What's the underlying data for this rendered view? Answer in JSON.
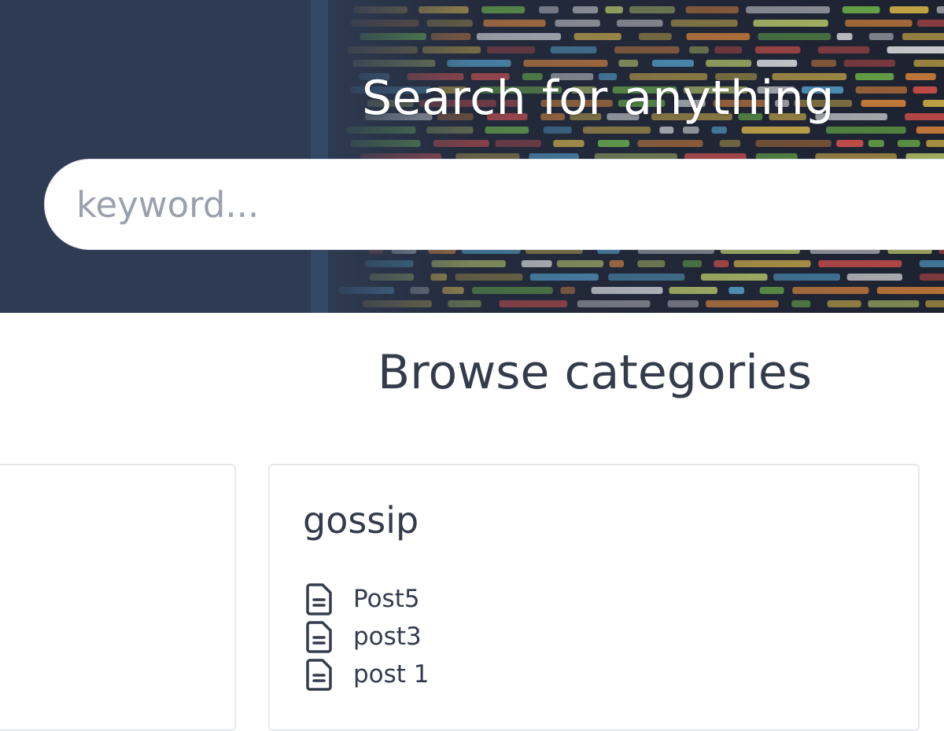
{
  "hero": {
    "title": "Search for anything",
    "search_placeholder": "keyword..."
  },
  "browse": {
    "title": "Browse categories"
  },
  "categories": [
    {
      "name": "gossip",
      "posts": [
        "Post5",
        "post3",
        "post 1"
      ]
    }
  ],
  "colors": {
    "hero_bg": "#2f3b52",
    "text_dark": "#343c4c",
    "placeholder": "#9aa1ad",
    "card_border": "#e6e8ec"
  },
  "icons": {
    "post": "document-icon"
  }
}
